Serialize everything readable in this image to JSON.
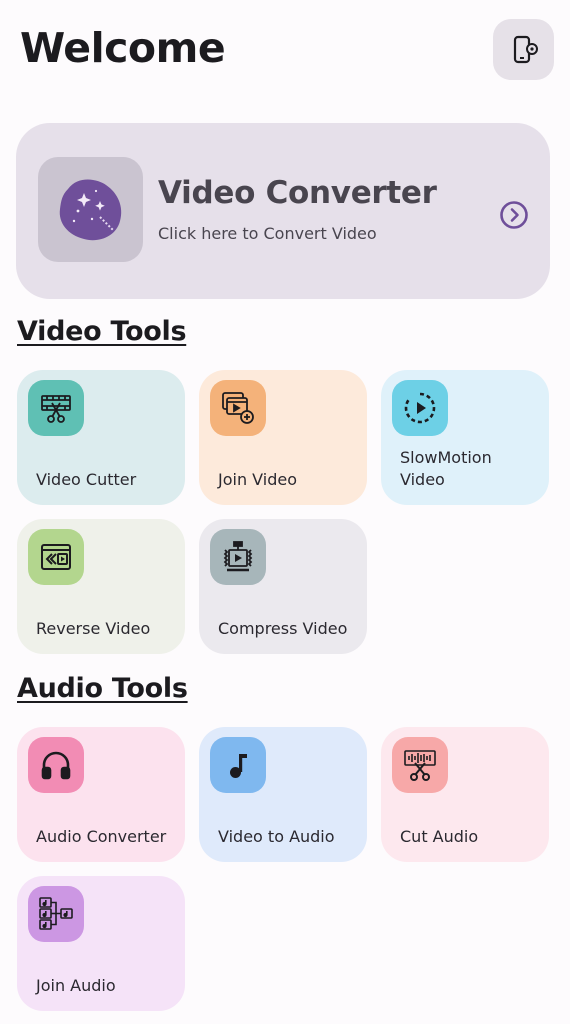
{
  "header": {
    "title": "Welcome"
  },
  "converter": {
    "title": "Video Converter",
    "subtitle": "Click here to Convert Video"
  },
  "video_tools": {
    "title": "Video Tools",
    "items": [
      {
        "label": "Video Cutter",
        "icon": "film-scissors-icon",
        "color": "#5fc0b4",
        "bg": "#dcecee"
      },
      {
        "label": "Join Video",
        "icon": "join-video-icon",
        "color": "#f4b27a",
        "bg": "#fdeadb"
      },
      {
        "label": "SlowMotion Video",
        "icon": "slow-motion-icon",
        "color": "#6dd0e6",
        "bg": "#dff1fa"
      },
      {
        "label": "Reverse Video",
        "icon": "reverse-video-icon",
        "color": "#b3d68e",
        "bg": "#eff1ea"
      },
      {
        "label": "Compress Video",
        "icon": "compress-video-icon",
        "color": "#a7b6ba",
        "bg": "#ebe9ee"
      }
    ]
  },
  "audio_tools": {
    "title": "Audio Tools",
    "items": [
      {
        "label": "Audio Converter",
        "icon": "headphones-icon",
        "color": "#f28cb4",
        "bg": "#fce2ee"
      },
      {
        "label": "Video to Audio",
        "icon": "music-note-icon",
        "color": "#7fb8ef",
        "bg": "#dfeafb"
      },
      {
        "label": "Cut Audio",
        "icon": "cut-audio-icon",
        "color": "#f7a8a8",
        "bg": "#fde8ee"
      },
      {
        "label": "Join Audio",
        "icon": "join-audio-icon",
        "color": "#cc97e3",
        "bg": "#f5e3f8"
      }
    ]
  },
  "colors": {
    "accent": "#6f4f9a",
    "card_bg": "#e6e0ea"
  }
}
